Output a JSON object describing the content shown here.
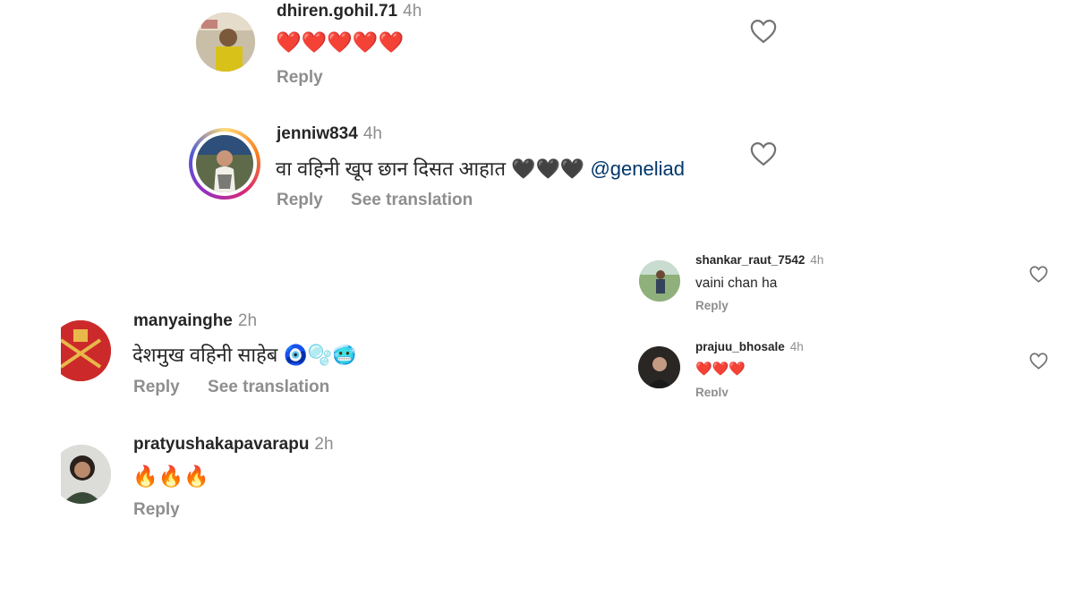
{
  "comments_left": [
    {
      "username": "dhiren.gohil.71",
      "time": "4h",
      "text": "❤️❤️❤️❤️❤️",
      "reply_label": "Reply"
    },
    {
      "username": "jenniw834",
      "time": "4h",
      "text": "वा वहिनी खूप छान दिसत आहात 🖤🖤🖤",
      "mention": "@geneliad",
      "reply_label": "Reply",
      "translate_label": "See translation"
    },
    {
      "username": "manyainghe",
      "time": "2h",
      "text": "देशमुख वहिनी साहेब 🧿🫧🥶",
      "reply_label": "Reply",
      "translate_label": "See translation"
    },
    {
      "username": "pratyushakapavarapu",
      "time": "2h",
      "text": "🔥🔥🔥",
      "reply_label": "Reply"
    }
  ],
  "comments_right": [
    {
      "username": "shankar_raut_7542",
      "time": "4h",
      "text": "vaini chan ha",
      "reply_label": "Reply"
    },
    {
      "username": "prajuu_bhosale",
      "time": "4h",
      "text": "❤️❤️❤️",
      "reply_label": "Reply"
    }
  ],
  "icons": {
    "like": "heart-outline-icon"
  },
  "colors": {
    "text": "#262626",
    "secondary": "#8e8e8e",
    "mention": "#00376b"
  }
}
